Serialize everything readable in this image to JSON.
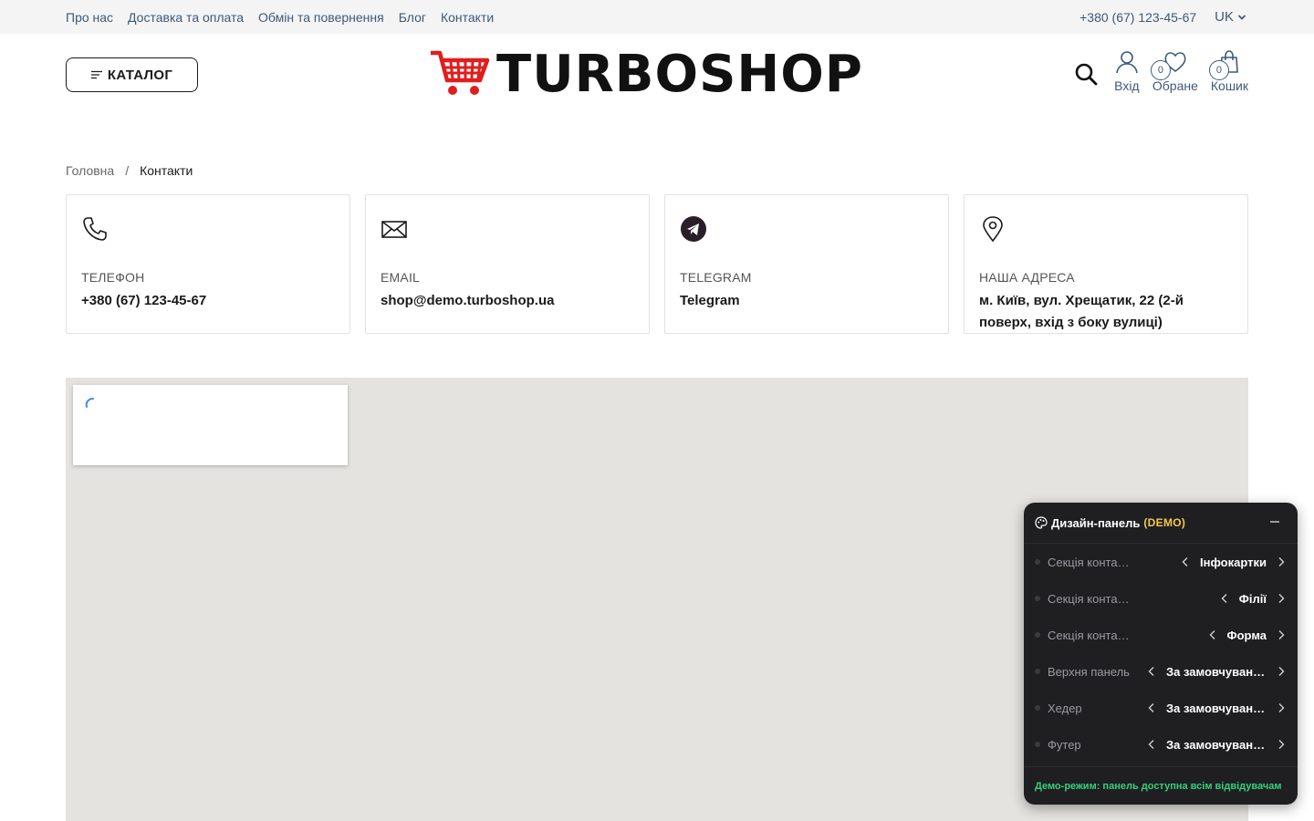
{
  "topbar": {
    "nav": [
      "Про нас",
      "Доставка та оплата",
      "Обмін та повернення",
      "Блог",
      "Контакти"
    ],
    "phone": "+380 (67) 123-45-67",
    "lang": "UK"
  },
  "header": {
    "catalog_label": "КАТАЛОГ",
    "logo_text": "TURBOSHOP",
    "login_label": "Вхід",
    "favorites_label": "Обране",
    "favorites_count": "0",
    "cart_label": "Кошик",
    "cart_count": "0"
  },
  "breadcrumb": {
    "home": "Головна",
    "separator": "/",
    "current": "Контакти"
  },
  "cards": [
    {
      "icon": "phone-icon",
      "title": "ТЕЛЕФОН",
      "value": "+380 (67) 123-45-67"
    },
    {
      "icon": "mail-icon",
      "title": "EMAIL",
      "value": "shop@demo.turboshop.ua"
    },
    {
      "icon": "telegram-icon",
      "title": "TELEGRAM",
      "value": "Telegram"
    },
    {
      "icon": "location-icon",
      "title": "НАША АДРЕСА",
      "value": "м. Київ, вул. Хрещатик, 22 (2-й поверх, вхід з боку вулиці)"
    }
  ],
  "panel": {
    "title": "Дизайн-панель",
    "demo_badge": "(DEMO)",
    "rows": [
      {
        "label": "Секція контактів",
        "value": "Інфокартки"
      },
      {
        "label": "Секція контактів",
        "value": "Філії"
      },
      {
        "label": "Секція контактів",
        "value": "Форма"
      },
      {
        "label": "Верхня панель",
        "value": "За замовчуванням"
      },
      {
        "label": "Хедер",
        "value": "За замовчуванням"
      },
      {
        "label": "Футер",
        "value": "За замовчуванням"
      }
    ],
    "footer_note": "Демо-режим: панель доступна всім відвідувачам"
  },
  "colors": {
    "link": "#3c5a78",
    "logo_cart": "#e11d1d",
    "panel_bg": "#1f1f22",
    "demo_accent": "#f2c94c",
    "demo_note": "#36d07a",
    "map_bg": "#e5e3df"
  }
}
